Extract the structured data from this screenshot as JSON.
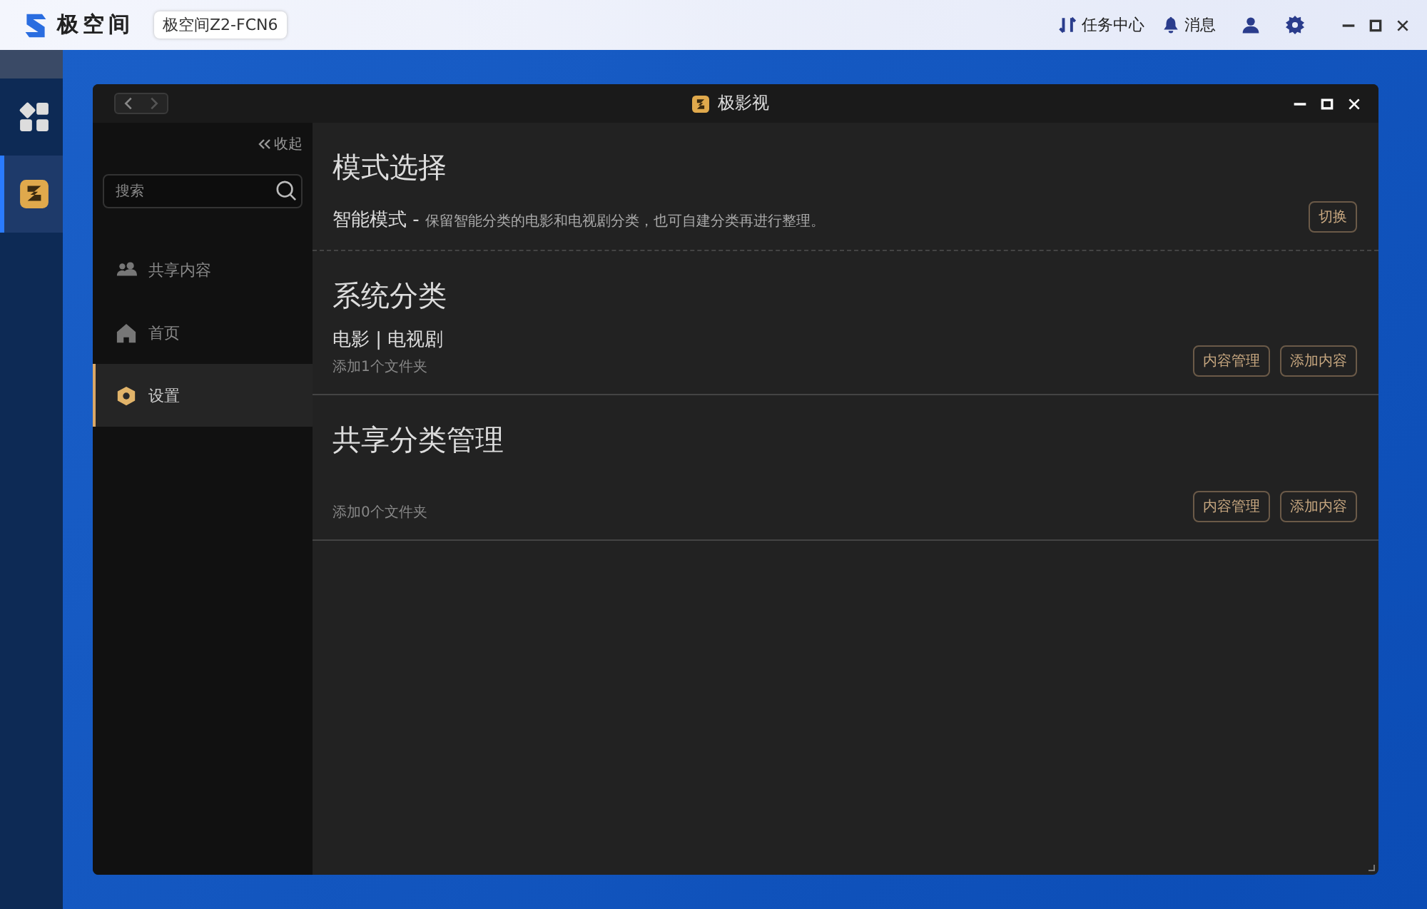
{
  "top_bar": {
    "brand": "极空间",
    "device": "极空间Z2-FCN6",
    "actions": [
      {
        "kind": "tasks",
        "label": "任务中心"
      },
      {
        "kind": "bell",
        "label": "消息"
      },
      {
        "kind": "user"
      },
      {
        "kind": "gear"
      }
    ]
  },
  "dock": {
    "items": [
      {
        "kind": "apps",
        "selected": false
      },
      {
        "kind": "video",
        "selected": true
      }
    ]
  },
  "window": {
    "title": "极影视",
    "sidebar": {
      "collapse": "收起",
      "search": {
        "placeholder": "搜索"
      },
      "items": [
        {
          "kind": "people",
          "label": "共享内容",
          "selected": false
        },
        {
          "kind": "home",
          "label": "首页",
          "selected": false
        },
        {
          "kind": "settings",
          "label": "设置",
          "selected": true
        }
      ]
    },
    "sections": [
      {
        "title": "模式选择",
        "mode_name": "智能模式 -",
        "description": "保留智能分类的电影和电视剧分类，也可自建分类再进行整理。",
        "buttons": [
          "切换"
        ]
      },
      {
        "title": "系统分类",
        "subtitle": "电影 | 电视剧",
        "note": "添加1个文件夹",
        "buttons": [
          "内容管理",
          "添加内容"
        ]
      },
      {
        "title": "共享分类管理",
        "note": "添加0个文件夹",
        "buttons": [
          "内容管理",
          "添加内容"
        ]
      }
    ]
  }
}
